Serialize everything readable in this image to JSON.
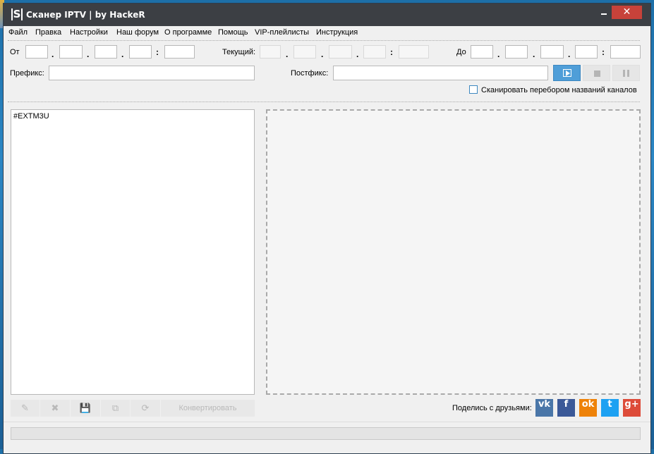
{
  "window": {
    "title": "Сканер IPTV | by HackeR",
    "app_icon": "S",
    "close_glyph": "✕"
  },
  "menu": [
    "Файл",
    "Правка",
    "Настройки",
    "Наш форум",
    "О программе",
    "Помощь",
    "VIP-плейлисты",
    "Инструкция"
  ],
  "range": {
    "from_label": "От",
    "current_label": "Текущий:",
    "to_label": "До",
    "dot": ".",
    "colon": ":"
  },
  "prefix": {
    "label": "Префикс:",
    "value": ""
  },
  "postfix": {
    "label": "Постфикс:",
    "value": ""
  },
  "controls": {
    "play": "play-icon",
    "stop": "stop-icon",
    "pause": "pause-icon"
  },
  "scan_names": {
    "label": "Сканировать перебором названий каналов",
    "checked": false
  },
  "playlist_text": "#EXTM3U",
  "toolbar": {
    "edit": "✎",
    "delete": "✖",
    "save": "💾",
    "copy": "⧉",
    "refresh": "⟳",
    "convert": "Конвертировать"
  },
  "share": {
    "label": "Поделись с друзьями:",
    "vk": "vk",
    "facebook": "f",
    "odnoklassniki": "ok",
    "twitter": "t",
    "gplus": "g+"
  },
  "colors": {
    "accent": "#4f9ed8",
    "vk": "#4a76a8",
    "facebook": "#3b5998",
    "odnoklassniki": "#ee8208",
    "twitter": "#1da1f2",
    "gplus": "#dd4b39"
  },
  "progress": 0
}
